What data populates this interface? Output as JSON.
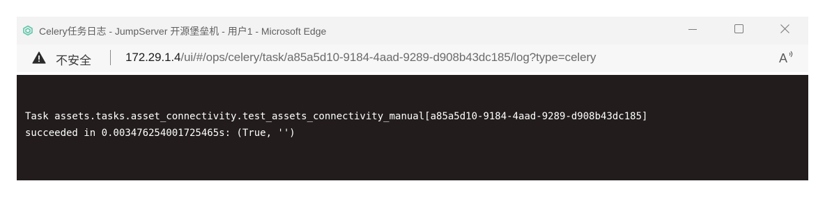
{
  "window": {
    "title": "Celery任务日志 - JumpServer 开源堡垒机 - 用户1 - Microsoft Edge",
    "icons": {
      "app": "jumpserver-logo-icon",
      "minimize": "minimize-icon",
      "maximize": "maximize-icon",
      "close": "close-icon"
    }
  },
  "addressbar": {
    "security_label": "不安全",
    "url_host": "172.29.1.4",
    "url_path": "/ui/#/ops/celery/task/a85a5d10-9184-4aad-9289-d908b43dc185/log?type=celery",
    "icons": {
      "warning": "warning-triangle-icon",
      "read_aloud": "read-aloud-icon"
    }
  },
  "console": {
    "lines": [
      "Task assets.tasks.asset_connectivity.test_assets_connectivity_manual[a85a5d10-9184-4aad-9289-d908b43dc185]",
      "succeeded in 0.003476254001725465s: (True, '')"
    ],
    "colors": {
      "background": "#221c1c",
      "text": "#ffffff"
    }
  }
}
